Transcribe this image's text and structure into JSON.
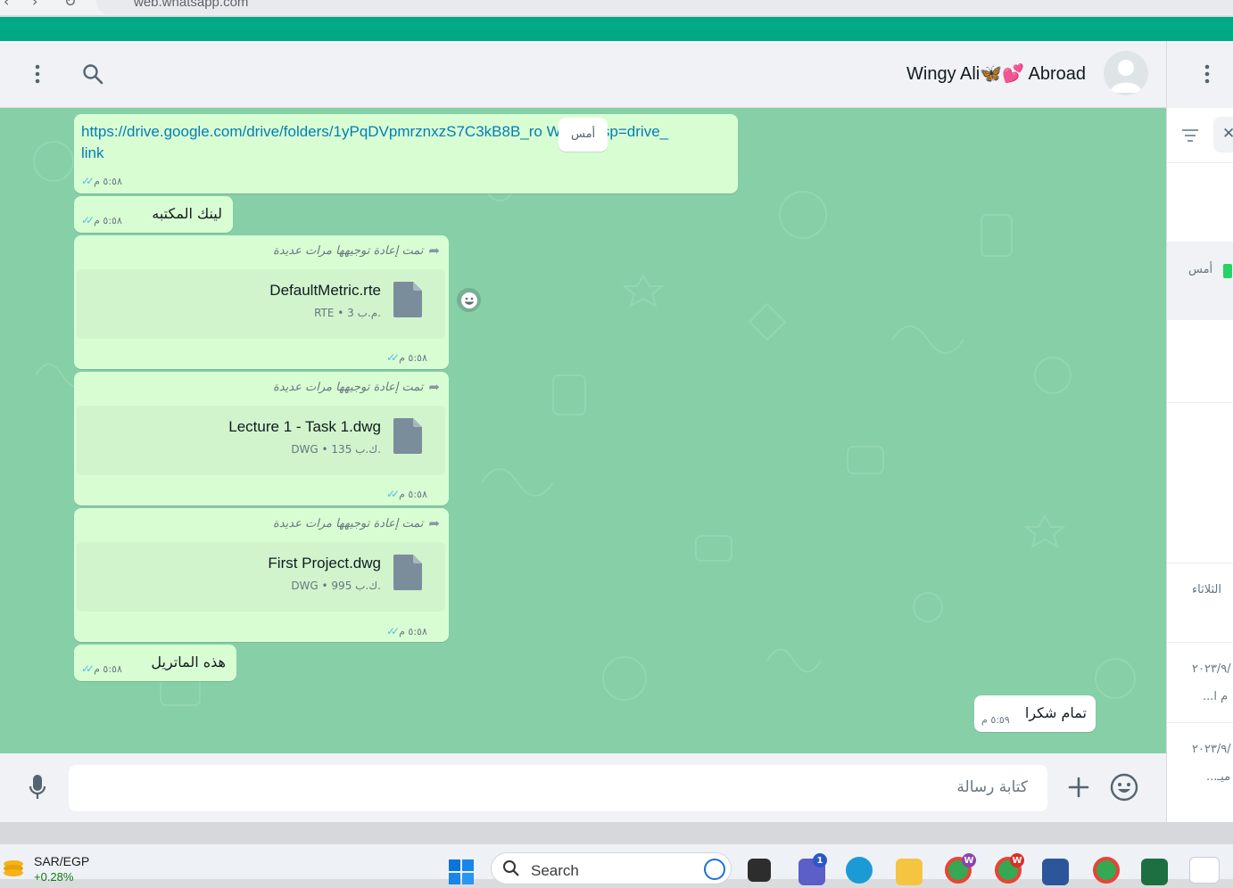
{
  "browser": {
    "url": "web.whatsapp.com"
  },
  "chat": {
    "contact_name": "Wingy Ali🦋💕 Abroad",
    "date_chip": "أمس",
    "messages": [
      {
        "type": "link",
        "text": "https://drive.google.com/drive/folders/1yPqDVpmrznxzS7C3kB8B_ro     WI7Q?usp=drive_link",
        "time": "٥:٥٨ م"
      },
      {
        "type": "text",
        "text": "لينك المكتبه",
        "time": "٥:٥٨ م"
      },
      {
        "type": "doc",
        "forwarded": "تمت إعادة توجيهها مرات عديدة",
        "name": "DefaultMetric.rte",
        "meta": "RTE • 3 م.ب.",
        "time": "٥:٥٨ م"
      },
      {
        "type": "doc",
        "forwarded": "تمت إعادة توجيهها مرات عديدة",
        "name": "Lecture 1 - Task 1.dwg",
        "meta": "DWG • 135 ك.ب.",
        "time": "٥:٥٨ م"
      },
      {
        "type": "doc",
        "forwarded": "تمت إعادة توجيهها مرات عديدة",
        "name": "First Project.dwg",
        "meta": "DWG • 995 ك.ب.",
        "time": "٥:٥٨ م"
      },
      {
        "type": "text",
        "text": "هذه الماتريل",
        "time": "٥:٥٨ م"
      },
      {
        "type": "incoming",
        "text": "تمام شكرا",
        "time": "٥:٥٩ م"
      }
    ]
  },
  "composer": {
    "placeholder": "كتابة رسالة"
  },
  "side_list": {
    "rows": [
      "أمس",
      "الثلاثاء",
      "٢٠٢٣/٩/",
      "م ا...",
      "٢٠٢٣/٩/",
      "ميـ..."
    ]
  },
  "taskbar": {
    "ticker_title": "SAR/EGP",
    "ticker_value": "+0.28%",
    "search_label": "Search",
    "teams_badge": "1"
  },
  "colors": {
    "accent": "#00a884",
    "chat_background": "#86cfa7",
    "outgoing_bubble": "#d9fdd3",
    "link": "#027eb5",
    "read_ticks": "#53bdeb"
  }
}
